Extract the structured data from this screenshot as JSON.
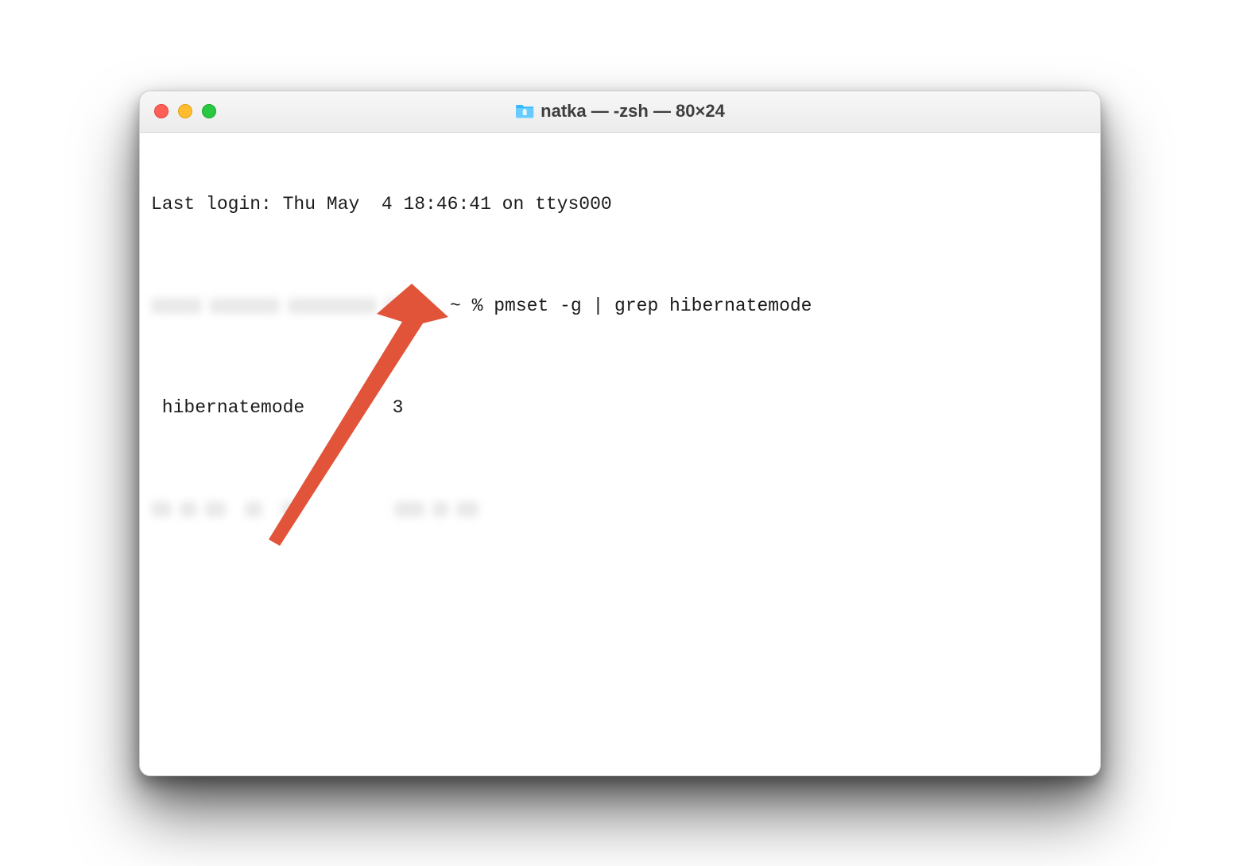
{
  "window": {
    "title": "natka — -zsh — 80×24"
  },
  "terminal": {
    "last_login": "Last login: Thu May  4 18:46:41 on ttys000",
    "prompt_suffix": "~ % ",
    "command": "pmset -g | grep hibernatemode",
    "output_label": " hibernatemode        ",
    "output_value": "3"
  },
  "annotation": {
    "arrow_color": "#E1543A"
  }
}
